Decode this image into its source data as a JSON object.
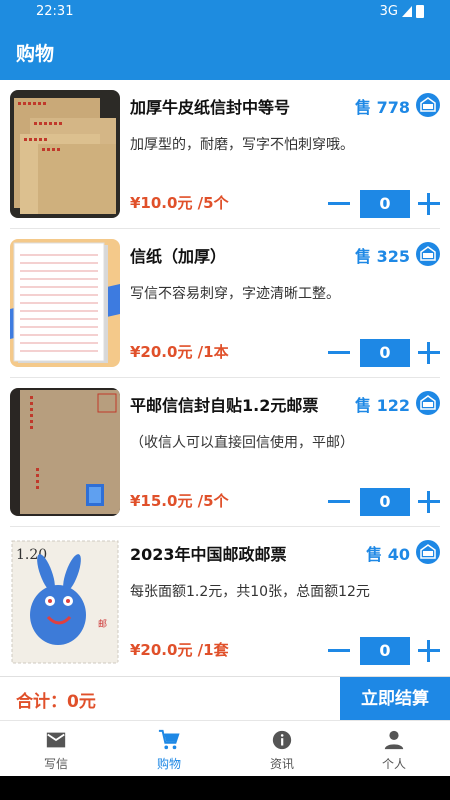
{
  "status_bar": {
    "time": "22:31",
    "network": "3G"
  },
  "app_bar": {
    "title": "购物"
  },
  "products": [
    {
      "name": "加厚牛皮纸信封中等号",
      "sold": "售 778",
      "desc": "加厚型的，耐磨，写字不怕刺穿哦。",
      "price": "¥10.0元 /5个",
      "qty": "0"
    },
    {
      "name": "信纸（加厚）",
      "sold": "售 325",
      "desc": "写信不容易刺穿，字迹清晰工整。",
      "price": "¥20.0元 /1本",
      "qty": "0"
    },
    {
      "name": "平邮信信封自贴1.2元邮票",
      "sold": "售 122",
      "desc": "（收信人可以直接回信使用，平邮）",
      "price": "¥15.0元 /5个",
      "qty": "0"
    },
    {
      "name": "2023年中国邮政邮票",
      "sold": "售 40",
      "desc": "每张面额1.2元，共10张，总面额12元",
      "price": "¥20.0元 /1套",
      "qty": "0"
    }
  ],
  "checkout": {
    "total": "合计：0元",
    "button": "立即结算"
  },
  "nav": [
    {
      "label": "写信",
      "icon": "mail-icon"
    },
    {
      "label": "购物",
      "icon": "cart-icon"
    },
    {
      "label": "资讯",
      "icon": "info-icon"
    },
    {
      "label": "个人",
      "icon": "person-icon"
    }
  ],
  "colors": {
    "primary": "#1e88e5",
    "price": "#e0502a",
    "appbar": "#1e8ce0"
  }
}
